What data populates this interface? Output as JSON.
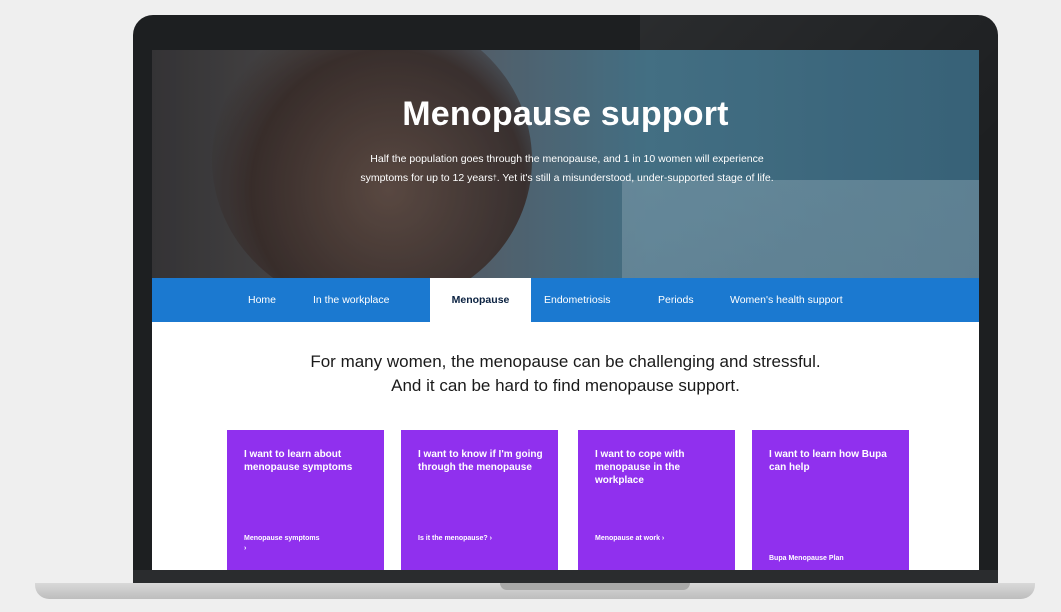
{
  "hero": {
    "title": "Menopause support",
    "subtitle_line1": "Half the population goes through the menopause, and 1 in 10 women will experience",
    "subtitle_line2_a": "symptoms for up to 12 years",
    "subtitle_sup": "†",
    "subtitle_line2_b": ". Yet it's still a misunderstood, under-supported stage of life."
  },
  "nav": {
    "items": [
      {
        "label": "Home"
      },
      {
        "label": "In the workplace"
      },
      {
        "label": "Menopause"
      },
      {
        "label": "Endometriosis"
      },
      {
        "label": "Periods"
      },
      {
        "label": "Women's health support"
      }
    ],
    "active": "Menopause"
  },
  "headline": {
    "line1": "For many women, the menopause can be challenging and stressful.",
    "line2": "And it can be hard to find menopause support."
  },
  "cards": [
    {
      "text": "I want to learn about menopause symptoms",
      "link": "Menopause symptoms",
      "arrow": "›"
    },
    {
      "text": "I want to know if I'm going through the menopause",
      "link": "Is it the menopause?",
      "arrow": "›"
    },
    {
      "text": "I want to cope with menopause in the workplace",
      "link": "Menopause at work",
      "arrow": "›"
    },
    {
      "text": "I want to learn how Bupa can help",
      "link": "Bupa Menopause Plan",
      "arrow": ""
    }
  ],
  "colors": {
    "nav_blue": "#1b79d0",
    "card_purple": "#9030ee",
    "laptop_frame": "#1d1f21"
  }
}
